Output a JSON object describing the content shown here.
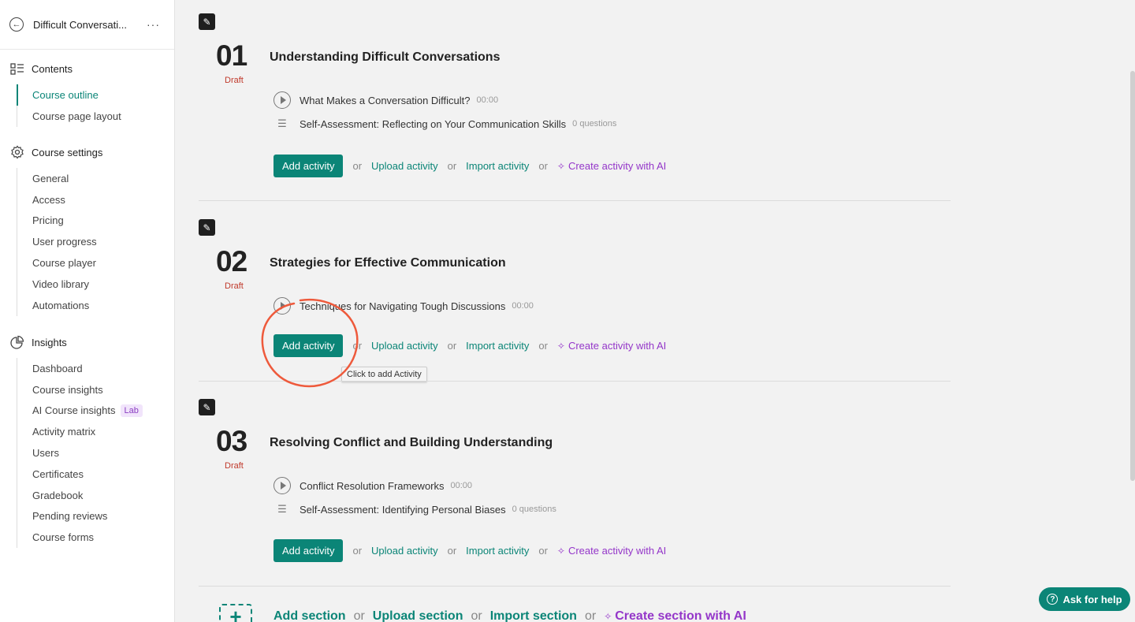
{
  "sidebar": {
    "course_title": "Difficult Conversati...",
    "more": "···",
    "groups": [
      {
        "title": "Contents",
        "icon": "list-icon",
        "items": [
          {
            "label": "Course outline",
            "active": true
          },
          {
            "label": "Course page layout"
          }
        ]
      },
      {
        "title": "Course settings",
        "icon": "gear-icon",
        "items": [
          {
            "label": "General"
          },
          {
            "label": "Access"
          },
          {
            "label": "Pricing"
          },
          {
            "label": "User progress"
          },
          {
            "label": "Course player"
          },
          {
            "label": "Video library"
          },
          {
            "label": "Automations"
          }
        ]
      },
      {
        "title": "Insights",
        "icon": "pie-chart-icon",
        "items": [
          {
            "label": "Dashboard"
          },
          {
            "label": "Course insights"
          },
          {
            "label": "AI Course insights",
            "badge": "Lab"
          },
          {
            "label": "Activity matrix"
          },
          {
            "label": "Users"
          },
          {
            "label": "Certificates"
          },
          {
            "label": "Gradebook"
          },
          {
            "label": "Pending reviews"
          },
          {
            "label": "Course forms"
          }
        ]
      }
    ]
  },
  "sections": [
    {
      "number": "01",
      "status": "Draft",
      "title": "Understanding Difficult Conversations",
      "activities": [
        {
          "type": "video",
          "title": "What Makes a Conversation Difficult?",
          "meta": "00:00"
        },
        {
          "type": "quiz",
          "title": "Self-Assessment: Reflecting on Your Communication Skills",
          "meta": "0 questions"
        }
      ]
    },
    {
      "number": "02",
      "status": "Draft",
      "title": "Strategies for Effective Communication",
      "activities": [
        {
          "type": "video",
          "title": "Techniques for Navigating Tough Discussions",
          "meta": "00:00"
        }
      ]
    },
    {
      "number": "03",
      "status": "Draft",
      "title": "Resolving Conflict and Building Understanding",
      "activities": [
        {
          "type": "video",
          "title": "Conflict Resolution Frameworks",
          "meta": "00:00"
        },
        {
          "type": "quiz",
          "title": "Self-Assessment: Identifying Personal Biases",
          "meta": "0 questions"
        }
      ]
    }
  ],
  "actions": {
    "add": "Add activity",
    "or": "or",
    "upload": "Upload activity",
    "import": "Import activity",
    "ai": "Create activity with AI"
  },
  "tooltip": "Click to add Activity",
  "bottom": {
    "add": "Add section",
    "or": "or",
    "upload": "Upload section",
    "import": "Import section",
    "ai": "Create section with AI"
  },
  "help": "Ask for help",
  "colors": {
    "accent": "#0b8577",
    "ai": "#9436c9",
    "draft": "#c0392b",
    "annotation": "#ee5a3c"
  }
}
